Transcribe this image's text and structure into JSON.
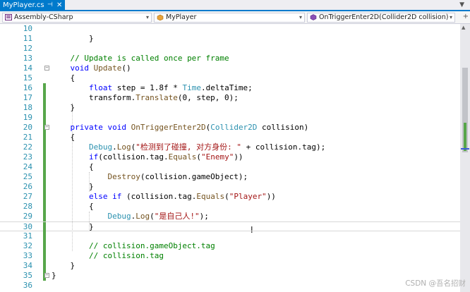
{
  "tab": {
    "title": "MyPlayer.cs",
    "pin_glyph": "⊣",
    "close_glyph": "✕"
  },
  "tabstrip": {
    "overflow_glyph": "▼"
  },
  "navbar": {
    "project": "Assembly-CSharp",
    "type": "MyPlayer",
    "member": "OnTriggerEnter2D(Collider2D collision)",
    "arrow_glyph": "▾",
    "split_glyph": "+"
  },
  "colors": {
    "keyword": "#0000ff",
    "type": "#2b91af",
    "string": "#a31515",
    "comment": "#008000",
    "method": "#74531f",
    "linenumber": "#2b91af",
    "change_saved": "#57a64a",
    "accent": "#007acc"
  },
  "code_lines": [
    {
      "n": "10",
      "text": "        "
    },
    {
      "n": "11",
      "text": "        }"
    },
    {
      "n": "12",
      "text": ""
    },
    {
      "n": "13",
      "text": "    // Update is called once per frame"
    },
    {
      "n": "14",
      "text": "    void Update()"
    },
    {
      "n": "15",
      "text": "    {"
    },
    {
      "n": "16",
      "text": "        float step = 1.8f * Time.deltaTime;"
    },
    {
      "n": "17",
      "text": "        transform.Translate(0, step, 0);"
    },
    {
      "n": "18",
      "text": "    }"
    },
    {
      "n": "19",
      "text": ""
    },
    {
      "n": "20",
      "text": "    private void OnTriggerEnter2D(Collider2D collision)"
    },
    {
      "n": "21",
      "text": "    {"
    },
    {
      "n": "22",
      "text": "        Debug.Log(\"检测到了碰撞, 对方身份: \" + collision.tag);"
    },
    {
      "n": "23",
      "text": "        if(collision.tag.Equals(\"Enemy\"))"
    },
    {
      "n": "24",
      "text": "        {"
    },
    {
      "n": "25",
      "text": "            Destroy(collision.gameObject);"
    },
    {
      "n": "26",
      "text": "        }"
    },
    {
      "n": "27",
      "text": "        else if (collision.tag.Equals(\"Player\"))"
    },
    {
      "n": "28",
      "text": "        {"
    },
    {
      "n": "29",
      "text": "            Debug.Log(\"是自己人!\");"
    },
    {
      "n": "30",
      "text": "        }"
    },
    {
      "n": "31",
      "text": ""
    },
    {
      "n": "32",
      "text": "        // collision.gameObject.tag"
    },
    {
      "n": "33",
      "text": "        // collision.tag"
    },
    {
      "n": "34",
      "text": "    }"
    },
    {
      "n": "35",
      "text": "}"
    },
    {
      "n": "36",
      "text": ""
    }
  ],
  "fold_markers": [
    "⊟",
    "⊟",
    "⊟"
  ],
  "watermark": "CSDN @吾名招财"
}
